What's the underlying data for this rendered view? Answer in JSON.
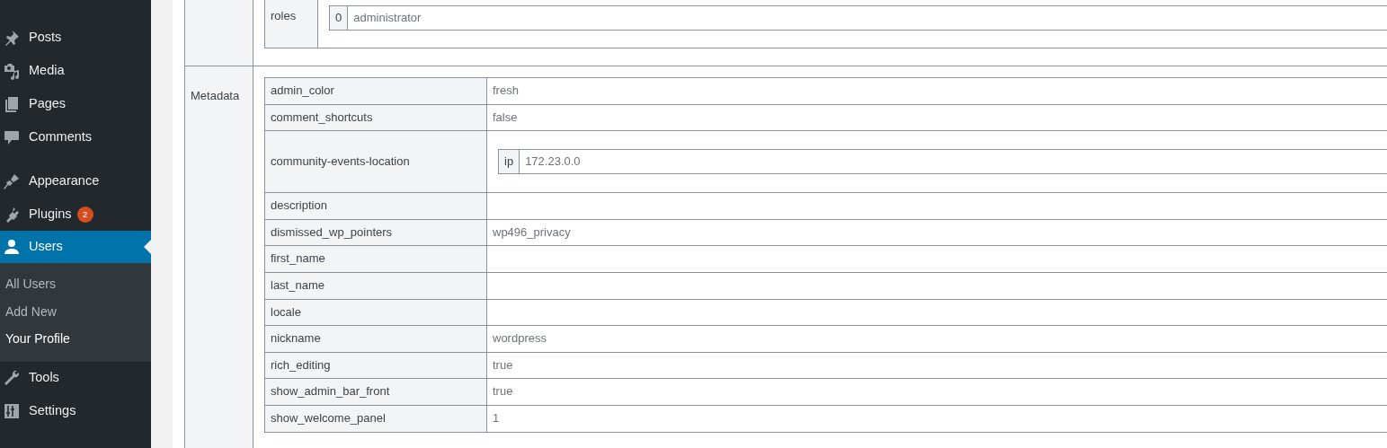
{
  "sidebar": {
    "groups": [
      [
        {
          "label": "Posts",
          "selected": false
        },
        {
          "label": "Media",
          "selected": false
        },
        {
          "label": "Pages",
          "selected": false
        },
        {
          "label": "Comments",
          "selected": false
        }
      ],
      [
        {
          "label": "Appearance",
          "selected": false
        },
        {
          "label": "Plugins",
          "badge": "2",
          "selected": false
        },
        {
          "label": "Users",
          "selected": true,
          "expanded": true,
          "children": [
            {
              "label": "All Users",
              "selected": false
            },
            {
              "label": "Add New",
              "selected": false
            },
            {
              "label": "Your Profile",
              "selected": true
            }
          ]
        },
        {
          "label": "Tools",
          "selected": false
        },
        {
          "label": "Settings",
          "selected": false
        }
      ]
    ]
  },
  "user_fields": [
    {
      "key": "roles",
      "values": [
        {
          "index": "0",
          "value": "administrator"
        }
      ]
    }
  ],
  "metadata": {
    "label": "Metadata",
    "rows": [
      {
        "key": "admin_color",
        "value": "fresh"
      },
      {
        "key": "comment_shortcuts",
        "value": "false"
      },
      {
        "key": "community-events-location",
        "values": [
          {
            "index": "ip",
            "value": "172.23.0.0"
          }
        ]
      },
      {
        "key": "description"
      },
      {
        "key": "dismissed_wp_pointers",
        "value": "wp496_privacy"
      },
      {
        "key": "first_name"
      },
      {
        "key": "last_name"
      },
      {
        "key": "locale"
      },
      {
        "key": "nickname",
        "value": "wordpress"
      },
      {
        "key": "rich_editing",
        "value": "true"
      },
      {
        "key": "show_admin_bar_front",
        "value": "true"
      },
      {
        "key": "show_welcome_panel",
        "value": "1"
      }
    ]
  }
}
